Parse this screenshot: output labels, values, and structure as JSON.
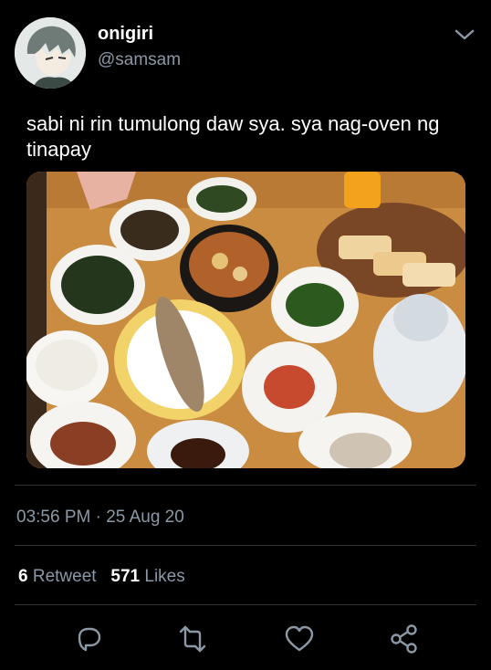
{
  "author": {
    "display_name": "onigiri",
    "handle": "@samsam"
  },
  "tweet": {
    "text": "sabi ni rin tumulong daw sya. sya nag-oven ng tinapay",
    "timestamp": "03:56 PM · 25 Aug 20"
  },
  "stats": {
    "retweets_count": "6",
    "retweets_label": "Retweet",
    "likes_count": "571",
    "likes_label": "Likes"
  },
  "icons": {
    "menu": "chevron-down-icon",
    "reply": "reply-icon",
    "retweet": "retweet-icon",
    "like": "heart-icon",
    "share": "share-icon"
  },
  "colors": {
    "background": "#000000",
    "secondary_text": "#8b98a5",
    "divider": "#2f3336"
  }
}
